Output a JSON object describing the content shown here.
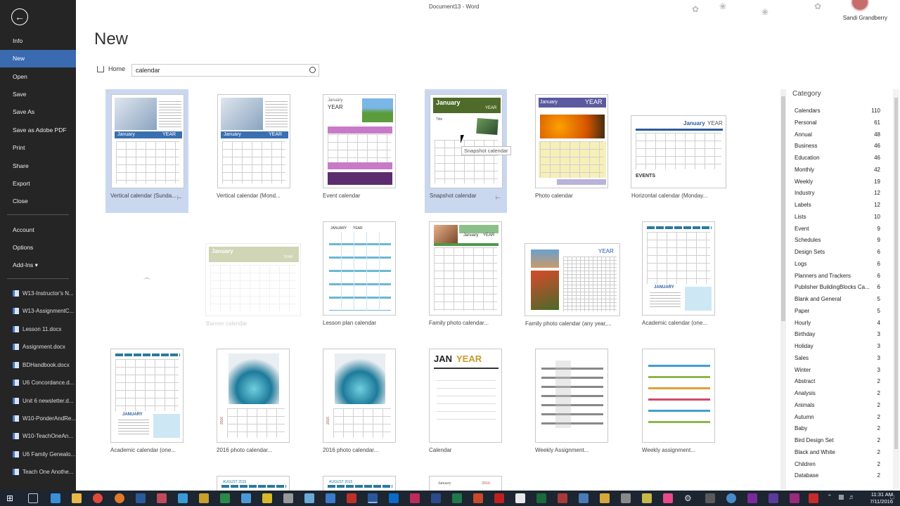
{
  "window": {
    "title": "Document13 - Word",
    "user": "Sandi Grandberry"
  },
  "sidebar": {
    "nav": [
      "Info",
      "New",
      "Open",
      "Save",
      "Save As",
      "Save as Adobe PDF",
      "Print",
      "Share",
      "Export",
      "Close"
    ],
    "nav2": [
      "Account",
      "Options",
      "Add-Ins ▾"
    ],
    "recent": [
      "W13-Instructor's N...",
      "W13-AssignmentC...",
      "Lesson 11.docx",
      "Assignment.docx",
      "BDHandbook.docx",
      "U6 Concordance.d...",
      "Unit 6 newsletter.d...",
      "W10-PonderAndRe...",
      "W10-TeachOneAn...",
      "U6 Family Genealo...",
      "Teach One Anothe..."
    ]
  },
  "main": {
    "title": "New",
    "home_label": "Home",
    "search_value": "calendar",
    "tooltip": "Snapshot calendar"
  },
  "templates": [
    "Vertical calendar (Sunda...",
    "Vertical calendar (Mond...",
    "Event calendar",
    "Snapshot calendar",
    "Photo calendar",
    "Horizontal calendar (Monday...",
    "Banner calendar",
    "Lesson plan calendar",
    "Family photo calendar...",
    "Family photo calendar (any year,...",
    "Academic calendar (one...",
    "Academic calendar (one...",
    "2016 photo calendar...",
    "2016 photo calendar...",
    "Calendar",
    "Weekly Assignment...",
    "Weekly assignment..."
  ],
  "thumb_text": {
    "january": "January",
    "year": "YEAR",
    "january_caps": "JANUARY",
    "jan": "JAN",
    "events": "EVENTS",
    "august": "AUGUST 2015",
    "title": "Title",
    "year_2016": "2016"
  },
  "category": {
    "title": "Category",
    "items": [
      {
        "name": "Calendars",
        "count": "110"
      },
      {
        "name": "Personal",
        "count": "61"
      },
      {
        "name": "Annual",
        "count": "48"
      },
      {
        "name": "Business",
        "count": "46"
      },
      {
        "name": "Education",
        "count": "46"
      },
      {
        "name": "Monthly",
        "count": "42"
      },
      {
        "name": "Weekly",
        "count": "19"
      },
      {
        "name": "Industry",
        "count": "12"
      },
      {
        "name": "Labels",
        "count": "12"
      },
      {
        "name": "Lists",
        "count": "10"
      },
      {
        "name": "Event",
        "count": "9"
      },
      {
        "name": "Schedules",
        "count": "9"
      },
      {
        "name": "Design Sets",
        "count": "6"
      },
      {
        "name": "Logs",
        "count": "6"
      },
      {
        "name": "Planners and Trackers",
        "count": "6"
      },
      {
        "name": "Publisher BuildingBlocks Ca...",
        "count": "6"
      },
      {
        "name": "Blank and General",
        "count": "5"
      },
      {
        "name": "Paper",
        "count": "5"
      },
      {
        "name": "Hourly",
        "count": "4"
      },
      {
        "name": "Birthday",
        "count": "3"
      },
      {
        "name": "Holiday",
        "count": "3"
      },
      {
        "name": "Sales",
        "count": "3"
      },
      {
        "name": "Winter",
        "count": "3"
      },
      {
        "name": "Abstract",
        "count": "2"
      },
      {
        "name": "Analysis",
        "count": "2"
      },
      {
        "name": "Animals",
        "count": "2"
      },
      {
        "name": "Autumn",
        "count": "2"
      },
      {
        "name": "Baby",
        "count": "2"
      },
      {
        "name": "Bird Design Set",
        "count": "2"
      },
      {
        "name": "Black and White",
        "count": "2"
      },
      {
        "name": "Children",
        "count": "2"
      },
      {
        "name": "Database",
        "count": "2"
      }
    ]
  },
  "taskbar": {
    "time": "11:31 AM",
    "date": "7/11/2016"
  },
  "colors": {
    "sidebar": "#252525",
    "active": "#3a6ab0",
    "selected_tile": "#c9d8ef",
    "accent_blue": "#2b579a"
  }
}
